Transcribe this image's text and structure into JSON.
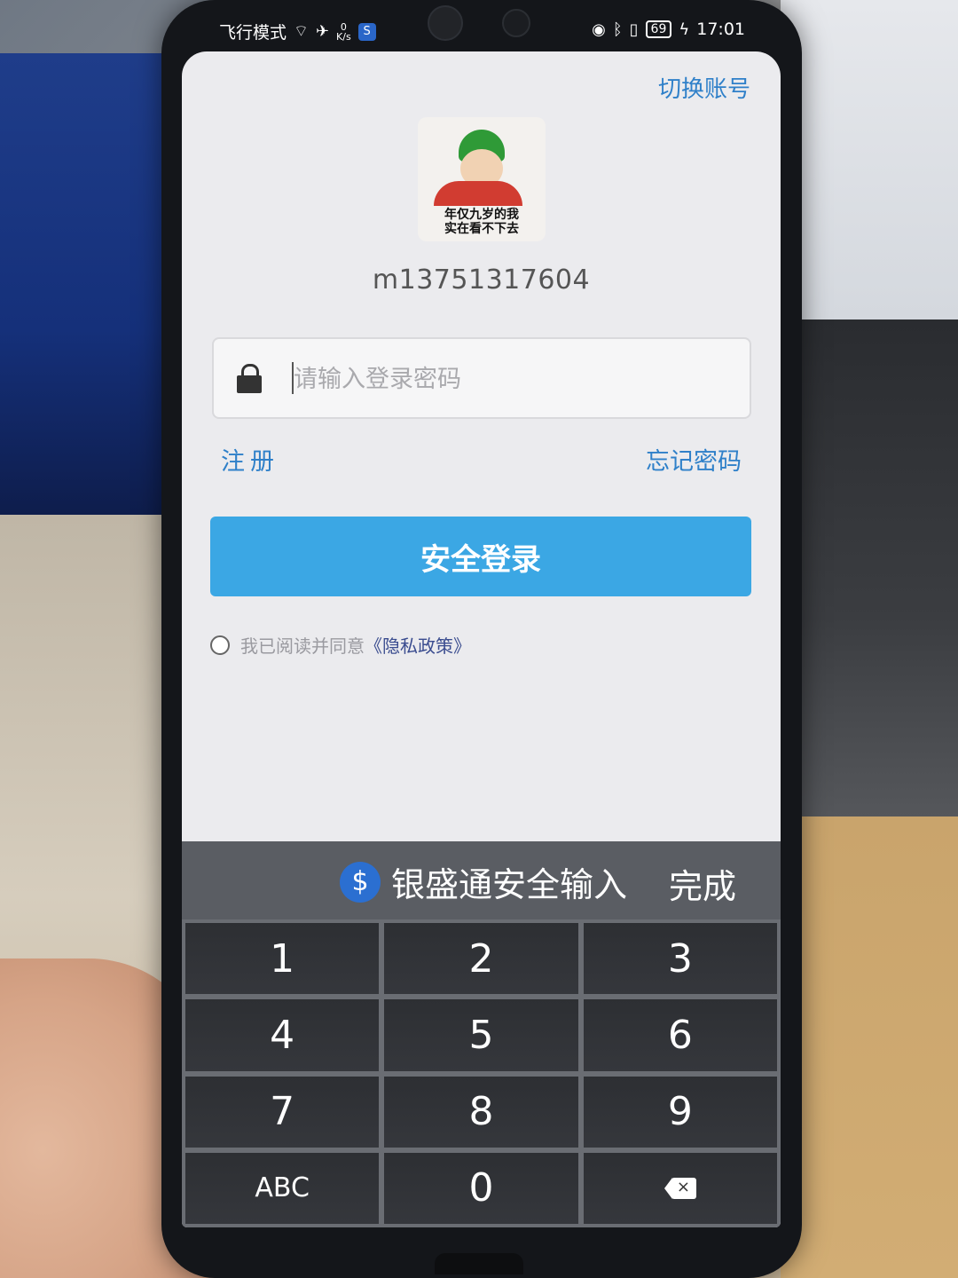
{
  "status_bar": {
    "left_text": "飞行模式",
    "net_speed_value": "0",
    "net_speed_unit": "K/s",
    "app_badge": "S",
    "battery": "69",
    "time": "17:01"
  },
  "header": {
    "switch_account": "切换账号"
  },
  "avatar": {
    "caption_line1": "年仅九岁的我",
    "caption_line2": "实在看不下去"
  },
  "account": {
    "username": "m13751317604"
  },
  "password_field": {
    "placeholder": "请输入登录密码",
    "value": ""
  },
  "links": {
    "register": "注册",
    "forgot_password": "忘记密码"
  },
  "login_button": {
    "label": "安全登录"
  },
  "agreement": {
    "text": "我已阅读并同意",
    "link": "《隐私政策》",
    "checked": false
  },
  "keyboard": {
    "brand": "银盛通安全输入",
    "done": "完成",
    "keys": [
      "1",
      "2",
      "3",
      "4",
      "5",
      "6",
      "7",
      "8",
      "9",
      "ABC",
      "0",
      "backspace"
    ]
  },
  "colors": {
    "accent_link": "#2f80c9",
    "login_button": "#3ba7e4",
    "keyboard_key": "#2d2f33"
  }
}
